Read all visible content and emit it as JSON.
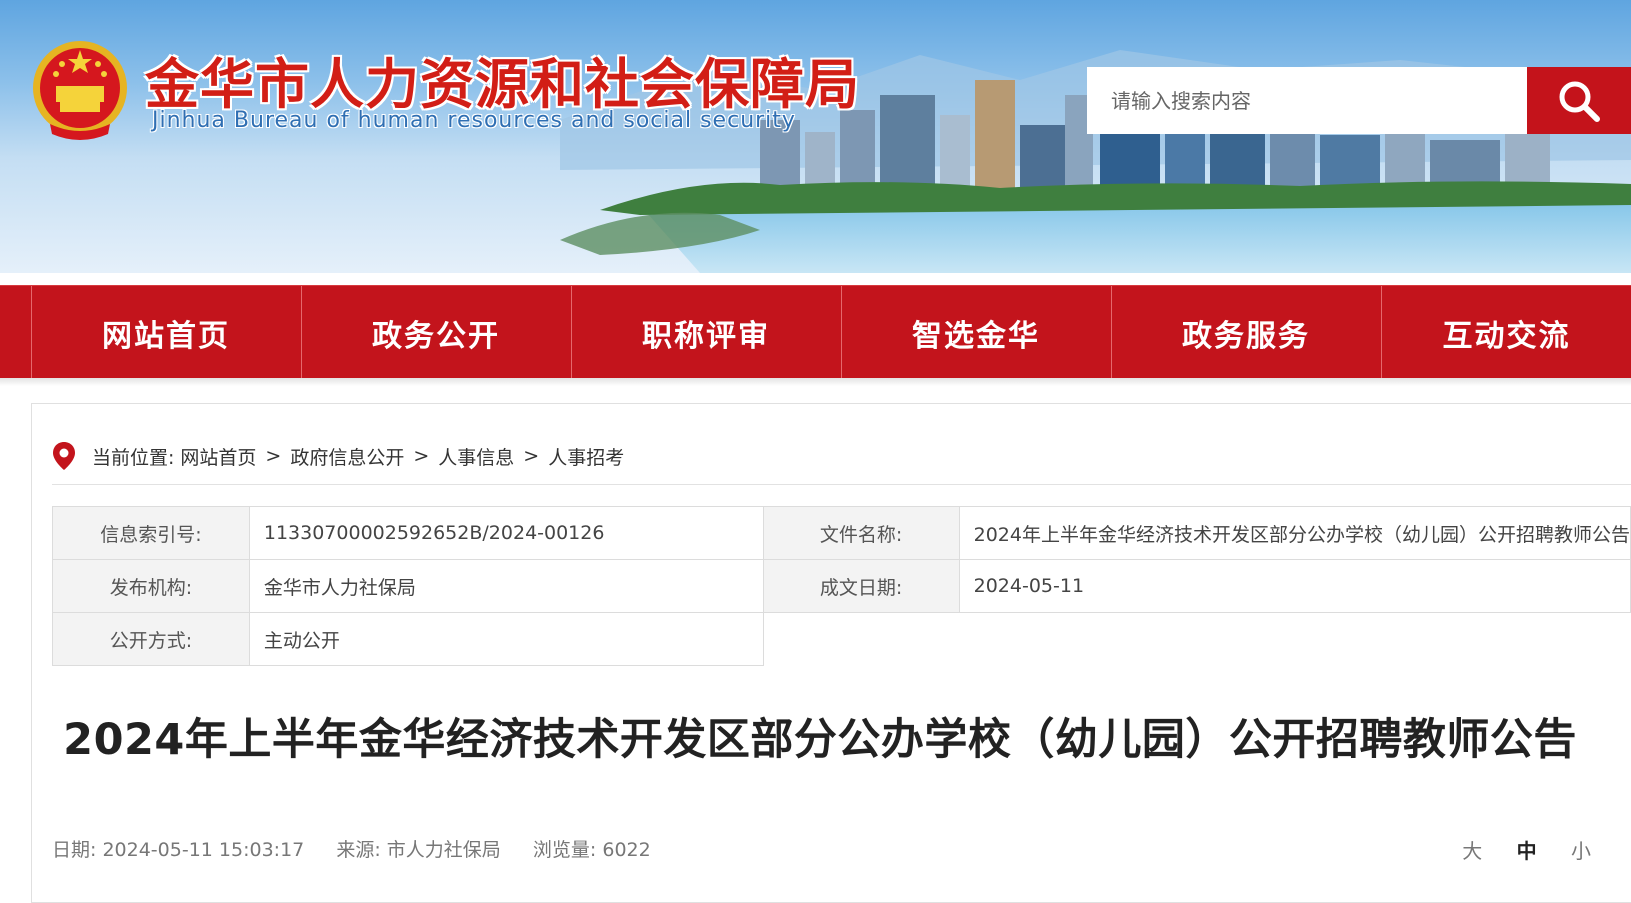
{
  "header": {
    "title": "金华市人力资源和社会保障局",
    "subtitle": "Jinhua Bureau of human resources and social security",
    "search_placeholder": "请输入搜索内容",
    "search_icon": "magnifier-icon",
    "emblem_icon": "national-emblem-icon"
  },
  "nav": {
    "items": [
      {
        "label": "网站首页"
      },
      {
        "label": "政务公开"
      },
      {
        "label": "职称评审"
      },
      {
        "label": "智选金华"
      },
      {
        "label": "政务服务"
      },
      {
        "label": "互动交流"
      }
    ]
  },
  "breadcrumb": {
    "icon": "location-pin-icon",
    "prefix": "当前位置:",
    "items": [
      "网站首页",
      "政府信息公开",
      "人事信息",
      "人事招考"
    ],
    "separator": ">"
  },
  "meta": {
    "index_label": "信息索引号:",
    "index_value": "11330700002592652B/2024-00126",
    "file_label": "文件名称:",
    "file_value": "2024年上半年金华经济技术开发区部分公办学校（幼儿园）公开招聘教师公告",
    "org_label": "发布机构:",
    "org_value": "金华市人力社保局",
    "date_label": "成文日期:",
    "date_value": "2024-05-11",
    "mode_label": "公开方式:",
    "mode_value": "主动公开"
  },
  "article": {
    "title": "2024年上半年金华经济技术开发区部分公办学校（幼儿园）公开招聘教师公告",
    "date_label": "日期:",
    "date_value": "2024-05-11 15:03:17",
    "source_label": "来源:",
    "source_value": "市人力社保局",
    "views_label": "浏览量:",
    "views_value": "6022"
  },
  "font_size": {
    "large": "大",
    "medium": "中",
    "small": "小",
    "active": "medium"
  },
  "colors": {
    "brand_red": "#c3141c",
    "title_red": "#d21e16",
    "subtitle_blue": "#2f6fb3"
  }
}
